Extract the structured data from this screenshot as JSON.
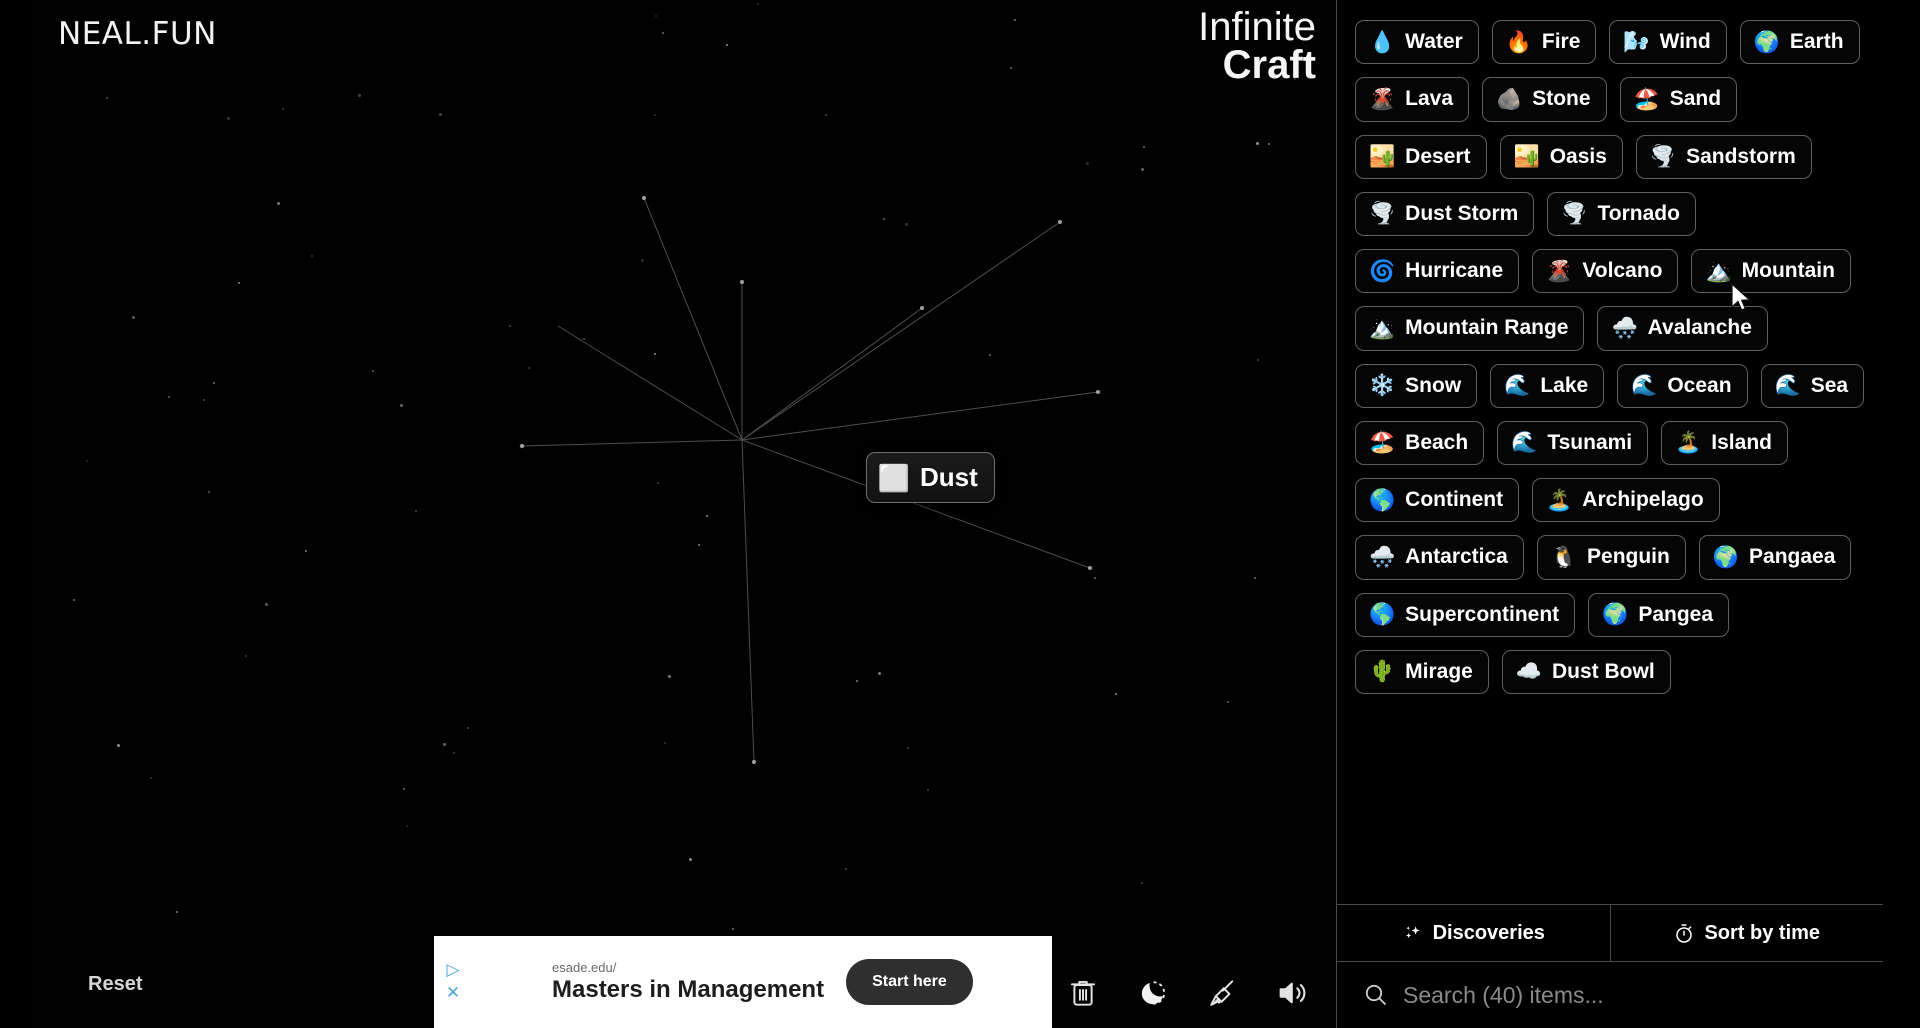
{
  "brand": {
    "logo": "NEAL.FUN"
  },
  "title": {
    "line1": "Infinite",
    "line2": "Craft"
  },
  "canvas": {
    "node": {
      "label": "Dust",
      "emoji": "⬜"
    },
    "reset_label": "Reset"
  },
  "toolbar": {
    "icons": [
      {
        "name": "trash-icon",
        "label": "Delete"
      },
      {
        "name": "moon-icon",
        "label": "Dark mode"
      },
      {
        "name": "broom-icon",
        "label": "Clear"
      },
      {
        "name": "speaker-icon",
        "label": "Sound"
      }
    ]
  },
  "ad": {
    "url": "esade.edu/",
    "headline": "Masters in Management",
    "cta": "Start here",
    "play_glyph": "▷",
    "close_glyph": "✕"
  },
  "sidebar": {
    "items": [
      {
        "emoji": "💧",
        "label": "Water"
      },
      {
        "emoji": "🔥",
        "label": "Fire"
      },
      {
        "emoji": "🌬️",
        "label": "Wind"
      },
      {
        "emoji": "🌍",
        "label": "Earth"
      },
      {
        "emoji": "🌋",
        "label": "Lava"
      },
      {
        "emoji": "🪨",
        "label": "Stone"
      },
      {
        "emoji": "🏖️",
        "label": "Sand"
      },
      {
        "emoji": "🏜️",
        "label": "Desert"
      },
      {
        "emoji": "🏜️",
        "label": "Oasis"
      },
      {
        "emoji": "🌪️",
        "label": "Sandstorm"
      },
      {
        "emoji": "🌪️",
        "label": "Dust Storm"
      },
      {
        "emoji": "🌪️",
        "label": "Tornado"
      },
      {
        "emoji": "🌀",
        "label": "Hurricane"
      },
      {
        "emoji": "🌋",
        "label": "Volcano"
      },
      {
        "emoji": "🏔️",
        "label": "Mountain"
      },
      {
        "emoji": "🏔️",
        "label": "Mountain Range"
      },
      {
        "emoji": "🌨️",
        "label": "Avalanche"
      },
      {
        "emoji": "❄️",
        "label": "Snow"
      },
      {
        "emoji": "🌊",
        "label": "Lake"
      },
      {
        "emoji": "🌊",
        "label": "Ocean"
      },
      {
        "emoji": "🌊",
        "label": "Sea"
      },
      {
        "emoji": "🏖️",
        "label": "Beach"
      },
      {
        "emoji": "🌊",
        "label": "Tsunami"
      },
      {
        "emoji": "🏝️",
        "label": "Island"
      },
      {
        "emoji": "🌎",
        "label": "Continent"
      },
      {
        "emoji": "🏝️",
        "label": "Archipelago"
      },
      {
        "emoji": "🌨️",
        "label": "Antarctica"
      },
      {
        "emoji": "🐧",
        "label": "Penguin"
      },
      {
        "emoji": "🌍",
        "label": "Pangaea"
      },
      {
        "emoji": "🌎",
        "label": "Supercontinent"
      },
      {
        "emoji": "🌍",
        "label": "Pangea"
      },
      {
        "emoji": "🌵",
        "label": "Mirage"
      },
      {
        "emoji": "☁️",
        "label": "Dust Bowl"
      }
    ],
    "footer": {
      "discoveries_label": "Discoveries",
      "sort_label": "Sort by time",
      "search_placeholder": "Search (40) items..."
    }
  }
}
